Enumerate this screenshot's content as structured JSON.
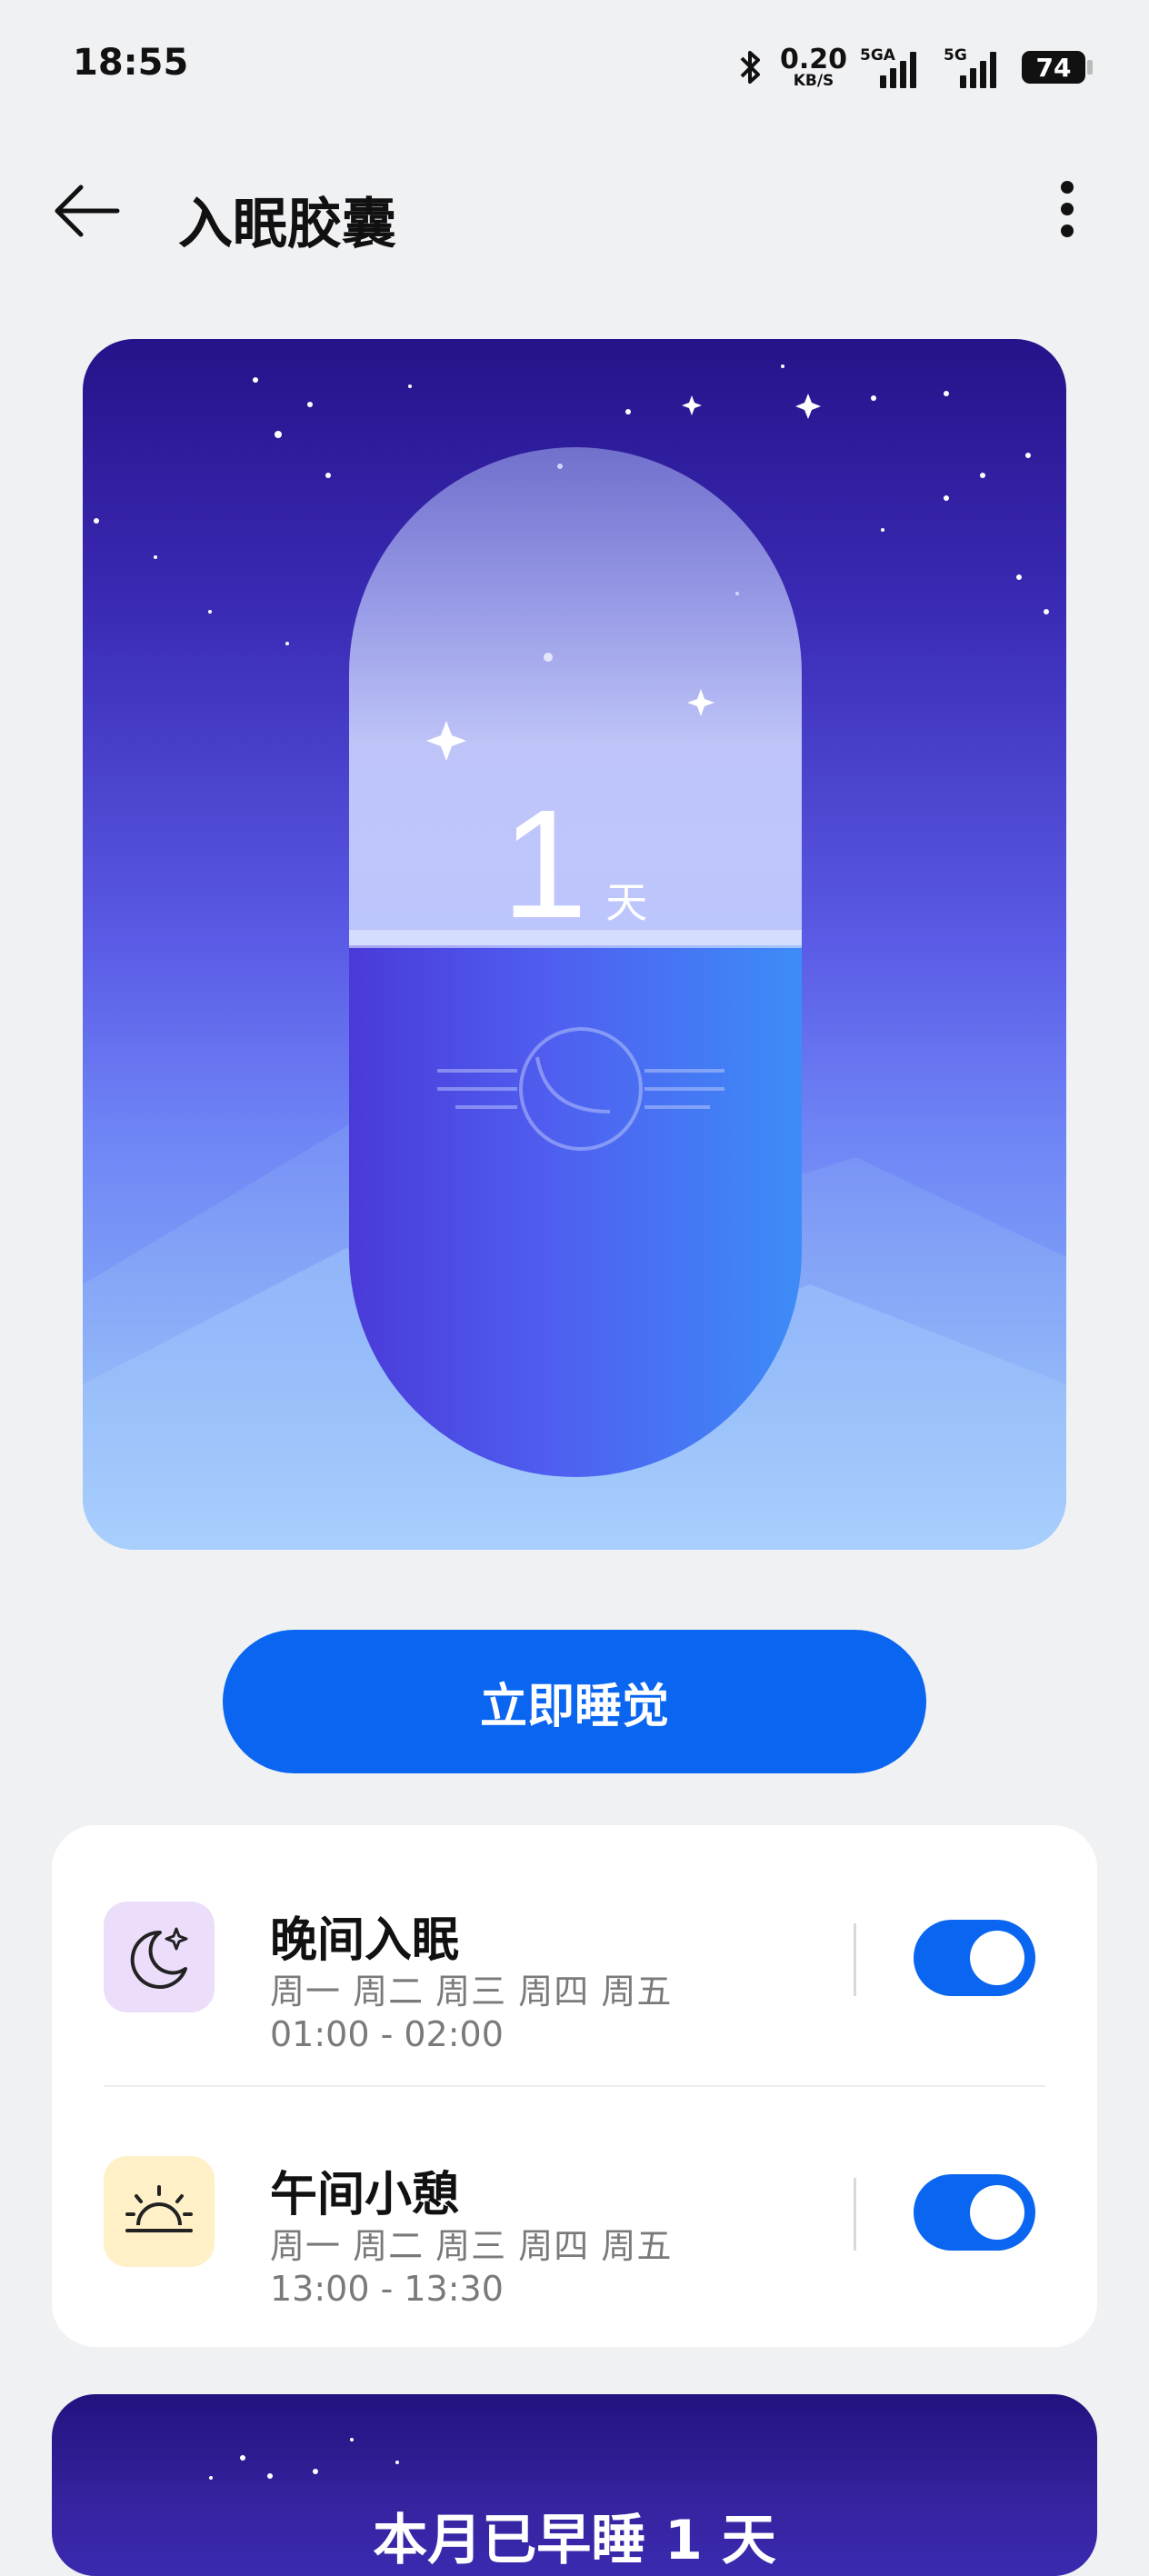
{
  "status_bar": {
    "time": "18:55",
    "net_speed": "0.20",
    "net_unit": "KB/S",
    "sim1": "5GA",
    "sim2": "5G",
    "battery": "74"
  },
  "header": {
    "title": "入眠胶囊"
  },
  "hero": {
    "count": "1",
    "unit": "天"
  },
  "sleep_now_label": "立即睡觉",
  "schedules": [
    {
      "name": "晚间入眠",
      "days": "周一 周二 周三 周四 周五",
      "time": "01:00 - 02:00",
      "enabled": true,
      "icon": "moon-stars-icon"
    },
    {
      "name": "午间小憩",
      "days": "周一 周二 周三 周四 周五",
      "time": "13:00 - 13:30",
      "enabled": true,
      "icon": "sunrise-icon"
    }
  ],
  "bottom_card": {
    "title": "本月已早睡 1 天"
  },
  "colors": {
    "accent": "#0a65f0",
    "hero_top": "#25138a",
    "hero_bottom": "#b4dcfd"
  }
}
